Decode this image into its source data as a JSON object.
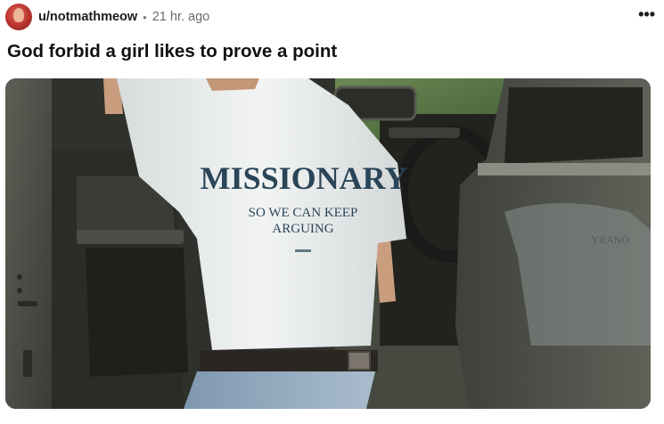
{
  "post": {
    "username": "u/notmathmeow",
    "separator": "•",
    "timestamp": "21 hr. ago",
    "more_icon": "more-horizontal-icon",
    "title": "God forbid a girl likes to prove a point"
  },
  "image": {
    "shirt_headline": "MISSIONARY",
    "shirt_line1": "SO WE CAN KEEP",
    "shirt_line2": "ARGUING",
    "reflection_text": "YЯANO"
  },
  "colors": {
    "shirt_print": "#2a4557",
    "shirt": "#eceff0",
    "car_body": "#55584e"
  }
}
